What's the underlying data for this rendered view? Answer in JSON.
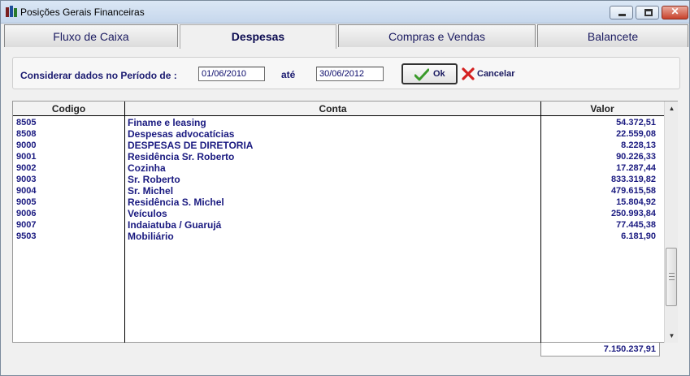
{
  "window": {
    "title": "Posições Gerais Financeiras"
  },
  "tabs": [
    {
      "label": "Fluxo de Caixa",
      "active": false
    },
    {
      "label": "Despesas",
      "active": true
    },
    {
      "label": "Compras e Vendas",
      "active": false
    },
    {
      "label": "Balancete",
      "active": false
    }
  ],
  "filter": {
    "period_label": "Considerar dados no Período de :",
    "start_date": "01/06/2010",
    "until_label": "até",
    "end_date": "30/06/2012",
    "ok_label": "Ok",
    "cancel_label": "Cancelar"
  },
  "table": {
    "headers": {
      "codigo": "Codigo",
      "conta": "Conta",
      "valor": "Valor"
    },
    "rows": [
      {
        "codigo": "8505",
        "conta": "Finame e leasing",
        "valor": "54.372,51"
      },
      {
        "codigo": "8508",
        "conta": "Despesas advocatícias",
        "valor": "22.559,08"
      },
      {
        "codigo": "9000",
        "conta": "DESPESAS DE DIRETORIA",
        "valor": "8.228,13"
      },
      {
        "codigo": "9001",
        "conta": "Residência Sr. Roberto",
        "valor": "90.226,33"
      },
      {
        "codigo": "9002",
        "conta": "Cozinha",
        "valor": "17.287,44"
      },
      {
        "codigo": "9003",
        "conta": "Sr. Roberto",
        "valor": "833.319,82"
      },
      {
        "codigo": "9004",
        "conta": "Sr. Michel",
        "valor": "479.615,58"
      },
      {
        "codigo": "9005",
        "conta": "Residência S. Michel",
        "valor": "15.804,92"
      },
      {
        "codigo": "9006",
        "conta": "Veículos",
        "valor": "250.993,84"
      },
      {
        "codigo": "9007",
        "conta": "Indaiatuba / Guarujá",
        "valor": "77.445,38"
      },
      {
        "codigo": "9503",
        "conta": "Mobiliário",
        "valor": "6.181,90"
      }
    ],
    "total": "7.150.237,91"
  },
  "colors": {
    "text_accent": "#1a1a80",
    "title_gradient_top": "#dbe7f5",
    "close_button": "#c8422c"
  }
}
